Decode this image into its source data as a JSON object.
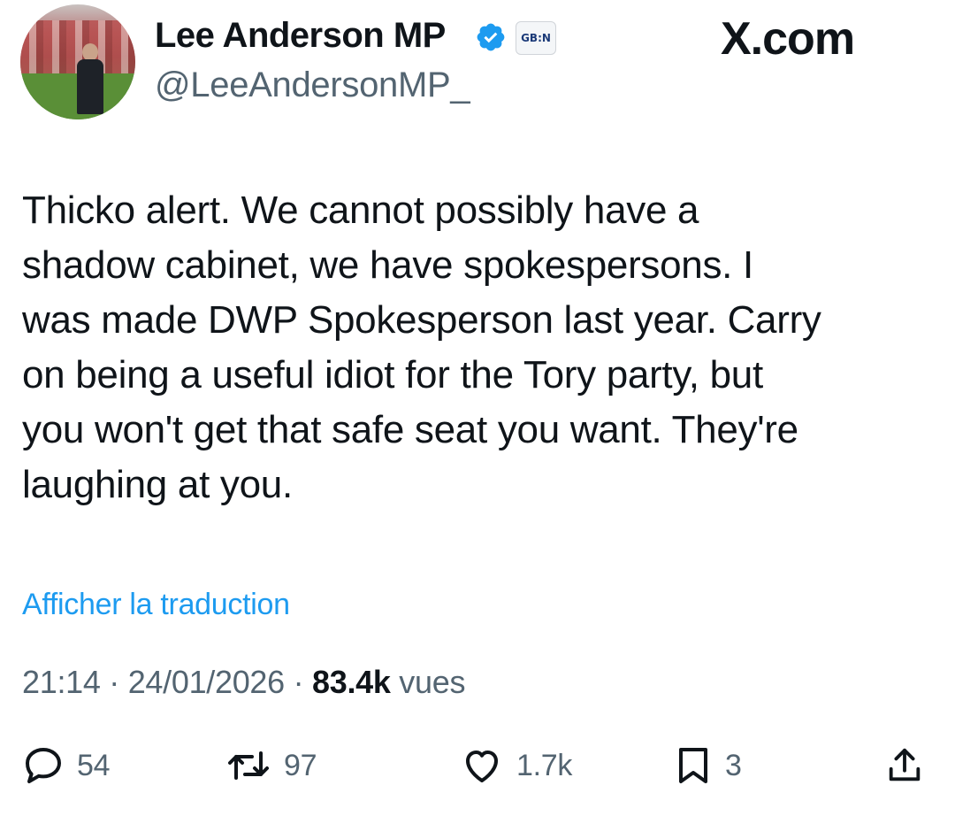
{
  "header": {
    "display_name": "Lee Anderson MP",
    "handle": "@LeeAndersonMP_",
    "affiliate_badge_text": "GB:N",
    "brand": "X.com",
    "verified_color": "#1d9bf0"
  },
  "tweet": {
    "text": "Thicko alert. We cannot possibly have a\nshadow cabinet, we have spokespersons. I\nwas made DWP Spokesperson last year. Carry\non being a useful idiot for the Tory party, but\nyou won't get that safe seat you want. They're\nlaughing at you.",
    "translate_link": "Afficher la traduction",
    "time": "21:14",
    "separator": "·",
    "date": "24/01/2026",
    "views_count": "83.4k",
    "views_label": "vues"
  },
  "actions": {
    "replies": "54",
    "reposts": "97",
    "likes": "1.7k",
    "bookmarks": "3"
  },
  "icons": {
    "reply": "speech-bubble-icon",
    "repost": "repost-arrows-icon",
    "like": "heart-icon",
    "bookmark": "bookmark-icon",
    "share": "share-upload-icon"
  },
  "colors": {
    "text": "#0f1419",
    "secondary": "#536471",
    "link": "#1d9bf0"
  }
}
